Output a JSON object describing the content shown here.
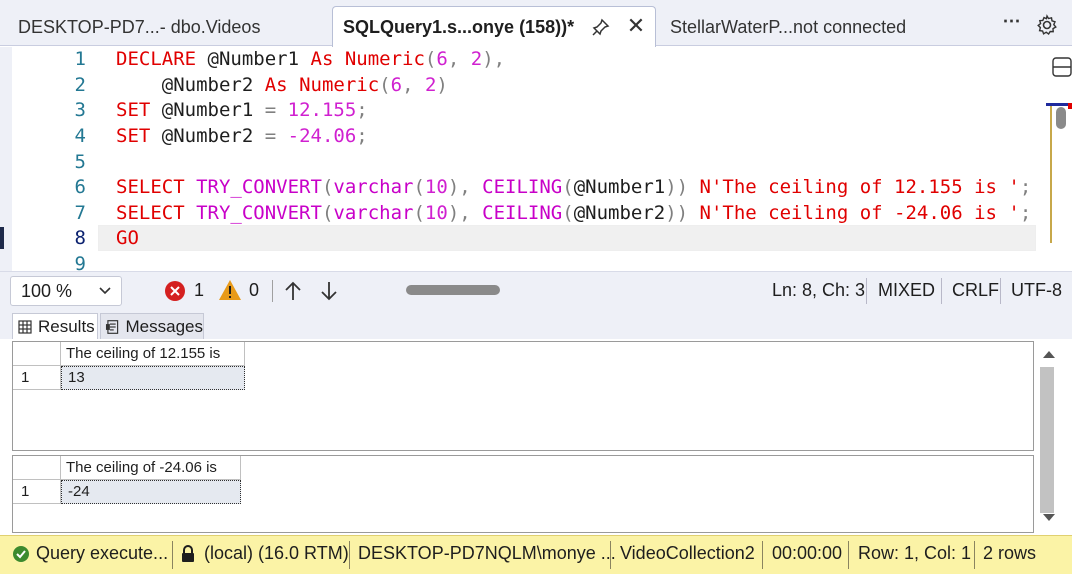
{
  "tabs": [
    {
      "label": "DESKTOP-PD7...- dbo.Videos",
      "active": false
    },
    {
      "label": "SQLQuery1.s...onye (158))*",
      "active": true
    },
    {
      "label": "StellarWaterP...not connected",
      "active": false
    }
  ],
  "tab_actions": {
    "more": "⋯",
    "settings_icon": "gear-icon"
  },
  "editor": {
    "line_numbers": [
      "1",
      "2",
      "3",
      "4",
      "5",
      "6",
      "7",
      "8",
      "9"
    ],
    "current_line": 8
  },
  "editor_status": {
    "zoom": "100 %",
    "errors": "1",
    "warnings": "0",
    "position": "Ln: 8, Ch: 3",
    "mode": "MIXED",
    "line_ending": "CRLF",
    "encoding": "UTF-8"
  },
  "results_tabs": {
    "results": "Results",
    "messages": "Messages"
  },
  "result_grids": [
    {
      "column": "The ceiling of 12.155 is",
      "row_number": "1",
      "value": "13"
    },
    {
      "column": "The ceiling of -24.06 is",
      "row_number": "1",
      "value": "-24"
    }
  ],
  "status_bar": {
    "query": "Query  execute...",
    "server": "(local) (16.0 RTM)",
    "user": "DESKTOP-PD7NQLM\\monye ...",
    "database": "VideoCollection2",
    "time": "00:00:00",
    "rowcol": "Row: 1, Col: 1",
    "rows": "2 rows"
  },
  "colors": {
    "keyword": "#e00000",
    "function": "#c800c8",
    "number": "#d020d0",
    "status_bar": "#fbf3a6",
    "tab_strip": "#eef0f7"
  }
}
